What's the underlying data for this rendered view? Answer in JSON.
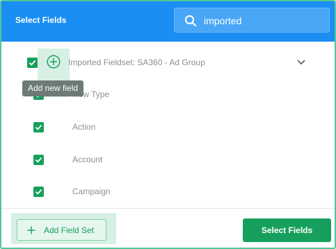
{
  "header": {
    "title": "Select Fields",
    "search": {
      "value": "imported",
      "placeholder": ""
    }
  },
  "fieldset": {
    "label": "Imported Fieldset: SA360 - Ad Group",
    "checked": true,
    "add_field_icon": "plus-circle-icon",
    "expand_icon": "chevron-down-icon"
  },
  "tooltip": {
    "text": "Add new field"
  },
  "fields": [
    {
      "label": "Row Type",
      "checked": true
    },
    {
      "label": "Action",
      "checked": true
    },
    {
      "label": "Account",
      "checked": true
    },
    {
      "label": "Campaign",
      "checked": true
    }
  ],
  "footer": {
    "add_field_set_label": "Add Field Set",
    "select_fields_label": "Select Fields"
  },
  "colors": {
    "header": "#1a8ef2",
    "primary_green": "#17a05d",
    "border_green": "#4fc79a",
    "tooltip_bg": "#6d7b74"
  }
}
